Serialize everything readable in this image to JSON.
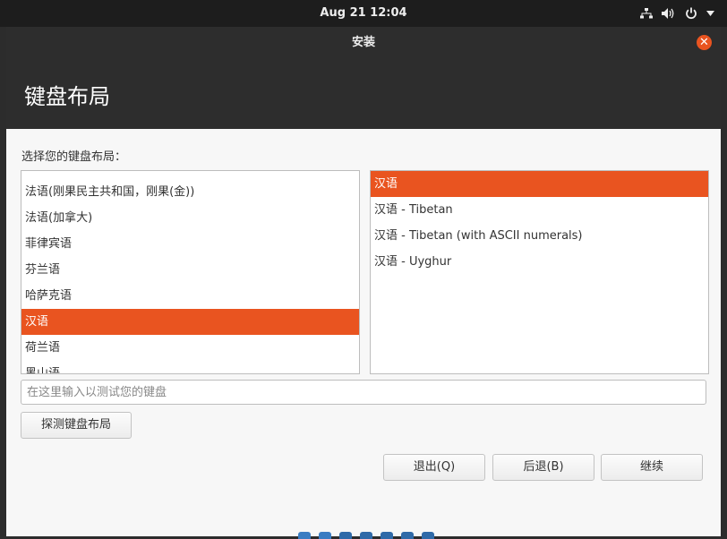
{
  "system_bar": {
    "clock": "Aug 21  12:04"
  },
  "window": {
    "title": "安装",
    "heading": "键盘布局",
    "prompt": "选择您的键盘布局：",
    "layouts": [
      "法语(刚果民主共和国，刚果(金))",
      "法语(加拿大)",
      "菲律宾语",
      "芬兰语",
      "哈萨克语",
      "汉语",
      "荷兰语",
      "黑山语"
    ],
    "selected_layout": "汉语",
    "variants": [
      "汉语",
      "汉语 - Tibetan",
      "汉语 - Tibetan (with ASCII numerals)",
      "汉语 - Uyghur"
    ],
    "selected_variant": "汉语",
    "test_input": {
      "placeholder": "在这里输入以测试您的键盘",
      "value": ""
    },
    "detect_button": "探测键盘布局",
    "quit_button": "退出(Q)",
    "back_button": "后退(B)",
    "continue_button": "继续"
  },
  "colors": {
    "accent": "#e95420",
    "titlebar": "#2d2d2d",
    "window_bg": "#f7f7f7"
  },
  "icons": {
    "network": "network-icon",
    "volume": "volume-icon",
    "power": "power-icon",
    "close": "close-icon"
  },
  "progress": {
    "total_steps": 7
  }
}
